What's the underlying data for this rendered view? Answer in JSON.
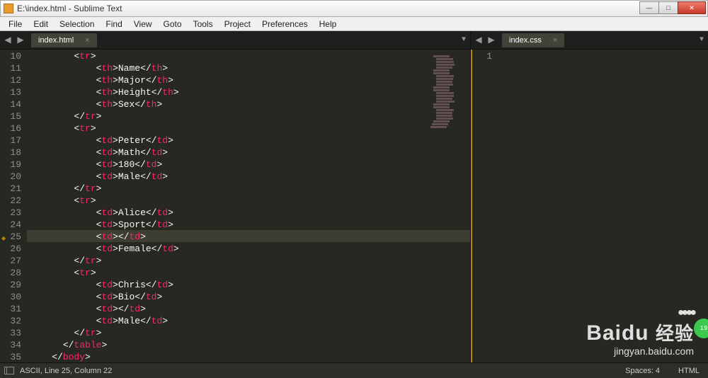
{
  "window": {
    "title": "E:\\index.html - Sublime Text"
  },
  "menu": {
    "items": [
      "File",
      "Edit",
      "Selection",
      "Find",
      "View",
      "Goto",
      "Tools",
      "Project",
      "Preferences",
      "Help"
    ]
  },
  "tabs": {
    "left": {
      "name": "index.html"
    },
    "right": {
      "name": "index.css"
    }
  },
  "editor_left": {
    "first_line": 10,
    "highlighted_line": 25,
    "marked_line": 25,
    "lines": [
      {
        "indent": 8,
        "open": "tr",
        "text": "",
        "close": ""
      },
      {
        "indent": 12,
        "open": "th",
        "text": "Name",
        "close": "th"
      },
      {
        "indent": 12,
        "open": "th",
        "text": "Major",
        "close": "th"
      },
      {
        "indent": 12,
        "open": "th",
        "text": "Height",
        "close": "th"
      },
      {
        "indent": 12,
        "open": "th",
        "text": "Sex",
        "close": "th"
      },
      {
        "indent": 8,
        "closeonly": "tr"
      },
      {
        "indent": 8,
        "open": "tr",
        "text": "",
        "close": ""
      },
      {
        "indent": 12,
        "open": "td",
        "text": "Peter",
        "close": "td"
      },
      {
        "indent": 12,
        "open": "td",
        "text": "Math",
        "close": "td"
      },
      {
        "indent": 12,
        "open": "td",
        "text": "180",
        "close": "td"
      },
      {
        "indent": 12,
        "open": "td",
        "text": "Male",
        "close": "td"
      },
      {
        "indent": 8,
        "closeonly": "tr"
      },
      {
        "indent": 8,
        "open": "tr",
        "text": "",
        "close": ""
      },
      {
        "indent": 12,
        "open": "td",
        "text": "Alice",
        "close": "td"
      },
      {
        "indent": 12,
        "open": "td",
        "text": "Sport",
        "close": "td"
      },
      {
        "indent": 12,
        "open": "td",
        "text": "",
        "close": "td"
      },
      {
        "indent": 12,
        "open": "td",
        "text": "Female",
        "close": "td"
      },
      {
        "indent": 8,
        "closeonly": "tr"
      },
      {
        "indent": 8,
        "open": "tr",
        "text": "",
        "close": ""
      },
      {
        "indent": 12,
        "open": "td",
        "text": "Chris",
        "close": "td"
      },
      {
        "indent": 12,
        "open": "td",
        "text": "Bio",
        "close": "td"
      },
      {
        "indent": 12,
        "open": "td",
        "text": "",
        "close": "td"
      },
      {
        "indent": 12,
        "open": "td",
        "text": "Male",
        "close": "td"
      },
      {
        "indent": 8,
        "closeonly": "tr"
      },
      {
        "indent": 6,
        "closeonly": "table"
      },
      {
        "indent": 4,
        "closeonly": "body"
      }
    ]
  },
  "editor_right": {
    "first_line": 1,
    "line_count": 1
  },
  "status": {
    "encoding": "ASCII",
    "position": "Line 25, Column 22",
    "spaces": "Spaces: 4",
    "syntax": "HTML"
  },
  "watermark": {
    "brand": "Baidu",
    "cn": "经验",
    "url": "jingyan.baidu.com"
  }
}
